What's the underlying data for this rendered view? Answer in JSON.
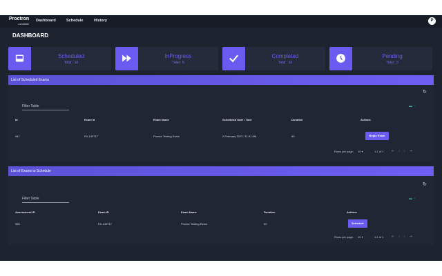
{
  "header": {
    "brand": "Proctron",
    "brand_sub": "Candidate",
    "nav": [
      "Dashboard",
      "Schedule",
      "History"
    ],
    "avatar_initial": "P"
  },
  "page_title": "DASHBOARD",
  "cards": [
    {
      "label": "Scheduled",
      "total": "Total : 10",
      "icon": "inbox-icon"
    },
    {
      "label": "InProgress",
      "total": "Total : 5",
      "icon": "fast-forward-icon"
    },
    {
      "label": "Completed",
      "total": "Total : 10",
      "icon": "checkmark-icon"
    },
    {
      "label": "Pending",
      "total": "Total : 3",
      "icon": "clock-icon"
    }
  ],
  "scheduled": {
    "title": "List of Scheduled Exams",
    "filter_placeholder": "Filter Table",
    "columns": [
      "Id",
      "Exam Id",
      "Exam Name",
      "Scheduled Date / Time",
      "Duration",
      "Actions"
    ],
    "rows": [
      {
        "id": "647",
        "exam_id": "EX-149717",
        "exam_name": "Proctor Testing Exam",
        "date": "2 February 2023 / 11:41 AM",
        "duration": "60",
        "action": "Begin Exam"
      }
    ],
    "rows_per_page_label": "Rows per page:",
    "rows_per_page": "10",
    "range": "1-1 of 1"
  },
  "to_schedule": {
    "title": "List of Exams to Schedule",
    "filter_placeholder": "Filter Table",
    "columns": [
      "Assessment ID",
      "Exam ID",
      "Exam Name",
      "Duration",
      "Actions"
    ],
    "rows": [
      {
        "assessment_id": "586",
        "exam_id": "EX-149717",
        "exam_name": "Proctor Testing Exam",
        "duration": "60",
        "action": "Schedule"
      }
    ],
    "rows_per_page_label": "Rows per page:",
    "rows_per_page": "10",
    "range": "1-1 of 1"
  },
  "colors": {
    "accent": "#6a5cf0",
    "background": "#1e2330",
    "panel": "#202634"
  }
}
